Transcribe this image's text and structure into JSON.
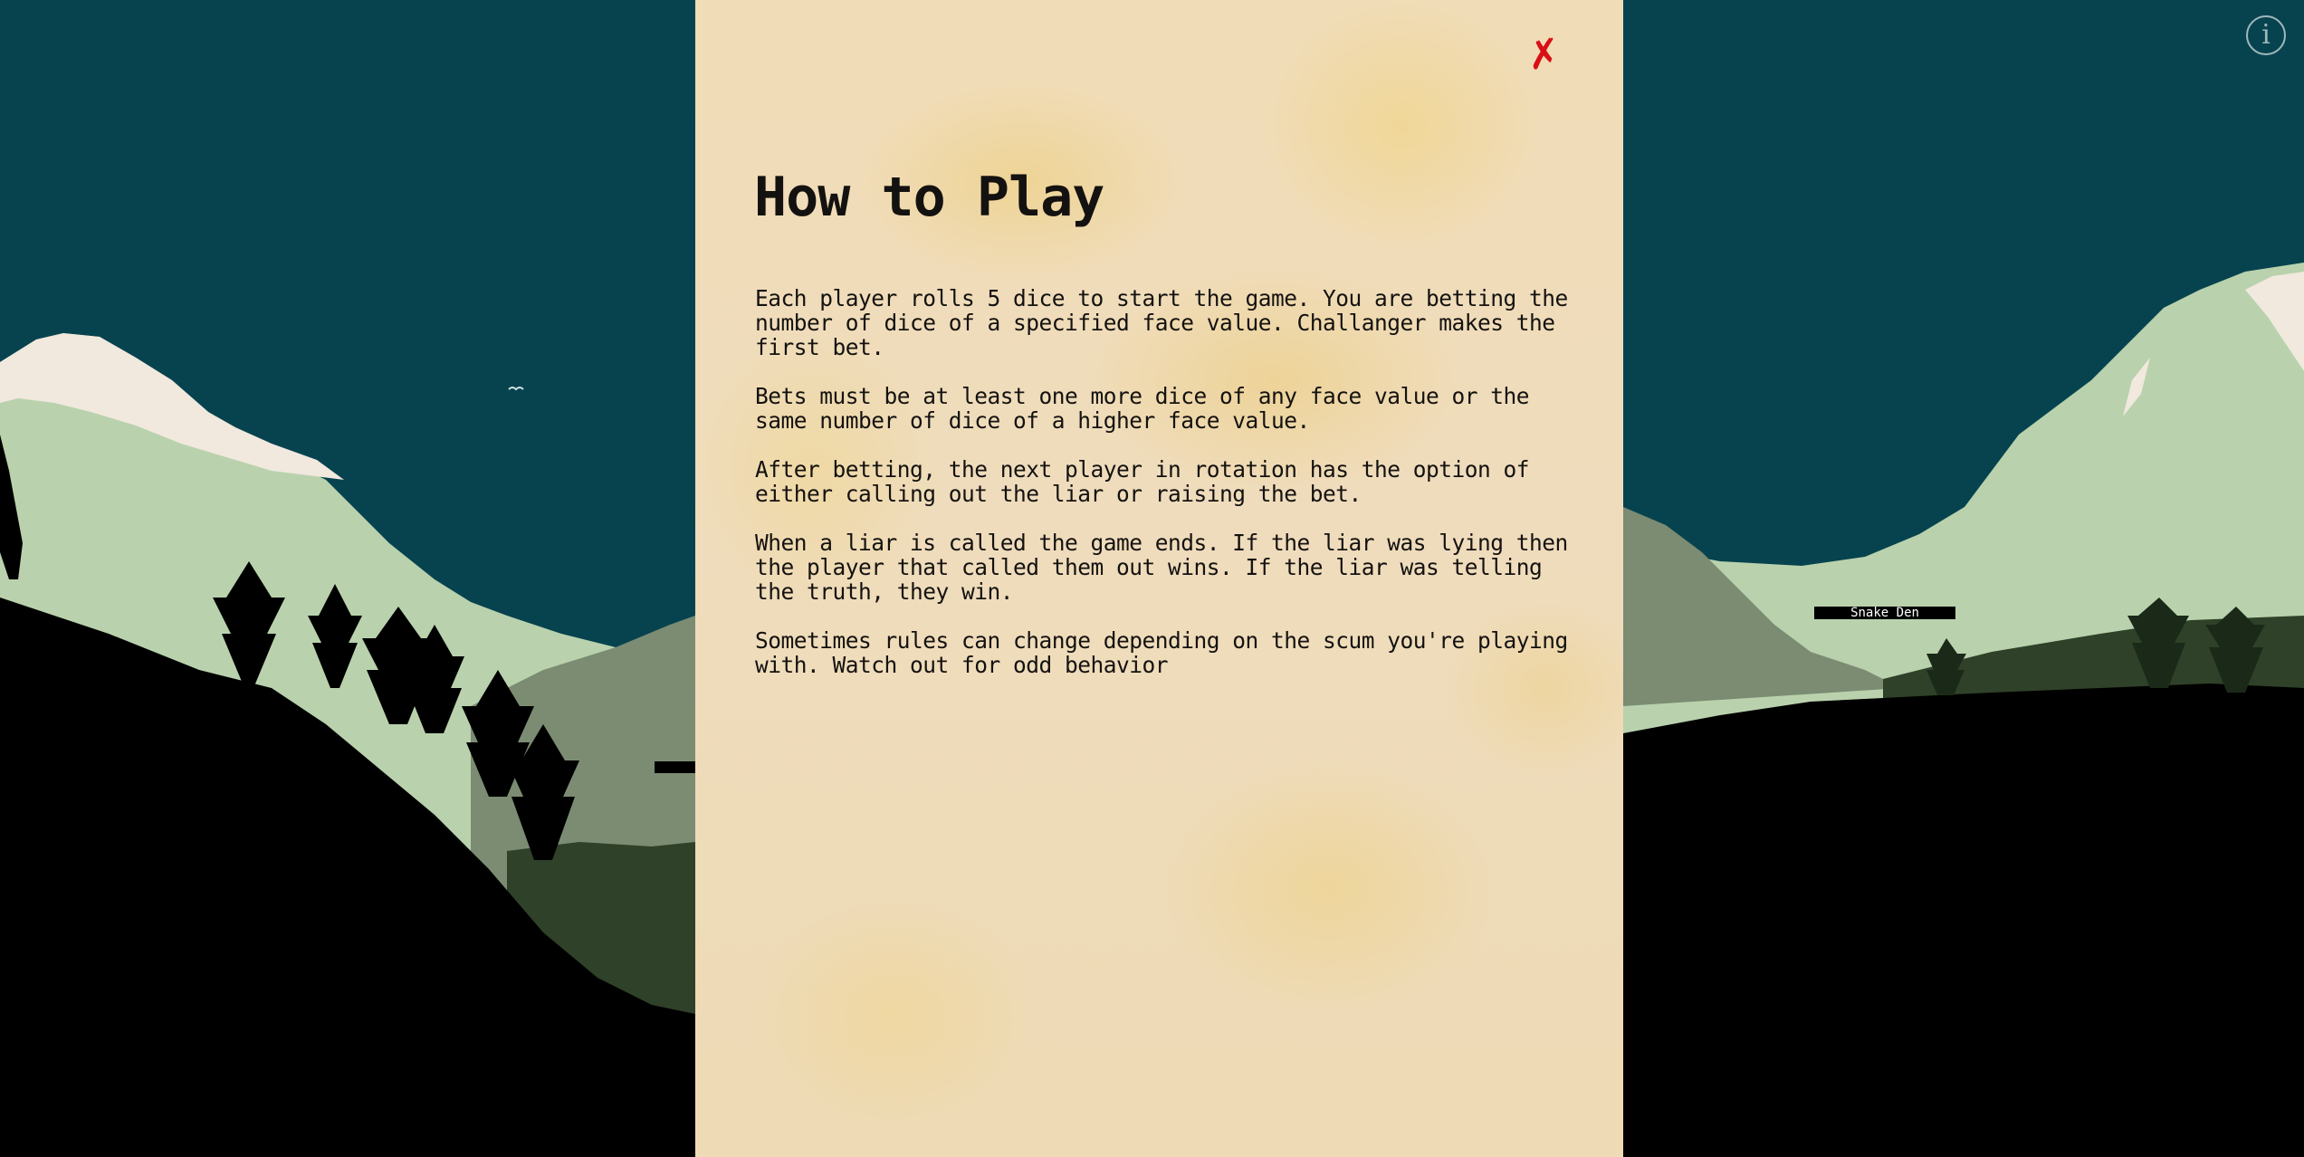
{
  "background": {
    "sky_color": "#07434f",
    "far_mountain_color": "#b9d2ad",
    "snow_color": "#f1e8de",
    "mid_hill_color": "#7b8c73",
    "dark_hill_color": "#2f4128",
    "silhouette_color": "#000000",
    "bird_icon": "bird-icon",
    "locations": {
      "right_label": "Snake Den",
      "left_label": ""
    }
  },
  "info_button": {
    "icon": "info-icon",
    "glyph": "i",
    "color": "#9fb8bb"
  },
  "rules_modal": {
    "close_glyph": "✗",
    "close_color": "#d90f16",
    "title": "How to Play",
    "paragraphs": [
      "Each player rolls 5 dice to start the game. You are betting the number of dice of a specified face value. Challanger makes the first bet.",
      "Bets must be at least one more dice of any face value or the same number of dice of a higher face value.",
      "After betting, the next player in rotation has the option of either calling out the liar or raising the bet.",
      "When a liar is called the game ends. If the liar was lying then the player that called them out wins. If the liar was telling the truth, they win.",
      "Sometimes rules can change depending on the scum you're playing with. Watch out for odd behavior"
    ]
  }
}
